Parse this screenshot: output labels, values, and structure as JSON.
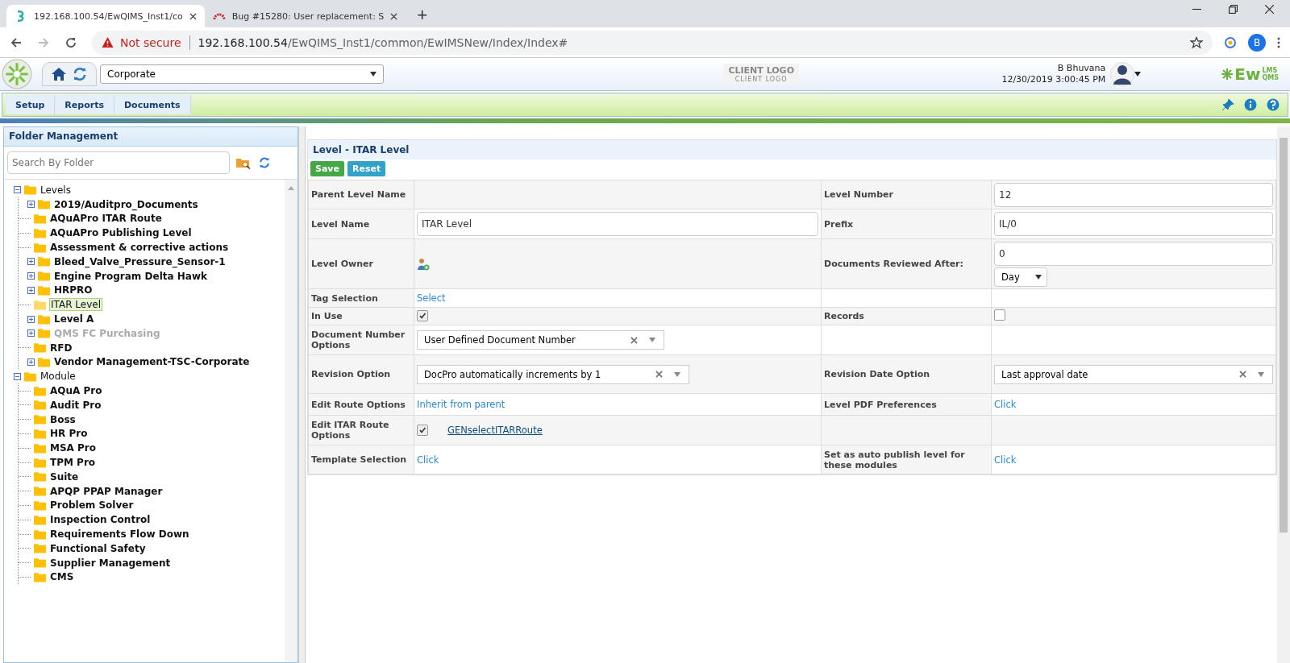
{
  "browser": {
    "tabs": [
      {
        "title": "192.168.100.54/EwQIMS_Inst1/co",
        "selected": true
      },
      {
        "title": "Bug #15280: User replacement: S",
        "selected": false
      }
    ],
    "new_tab": "+",
    "security": "Not secure",
    "url_host": "192.168.100.54",
    "url_path": "/EwQIMS_Inst1/common/EwIMSNew/Index/Index#",
    "profile": "B"
  },
  "header": {
    "site": "Corporate",
    "client_logo": "CLIENT LOGO",
    "client_logo_sub": "CLIENT LOGO",
    "user": "B Bhuvana",
    "datetime": "12/30/2019 3:00:45 PM",
    "brand": "Ew",
    "brand_sup": "LMS",
    "brand_sub": "QMS"
  },
  "menu": [
    "Setup",
    "Reports",
    "Documents"
  ],
  "folder_panel": {
    "title": "Folder Management",
    "search": {
      "placeholder": "Search By Folder"
    },
    "tree": [
      {
        "label": "Levels",
        "kind": "branch",
        "expanded": true,
        "selected": false,
        "disabled": false,
        "children": [
          {
            "label": "2019/Auditpro_Documents",
            "kind": "branch",
            "expanded": false,
            "selected": false,
            "disabled": false
          },
          {
            "label": "AQuAPro ITAR Route",
            "kind": "leaf",
            "selected": false,
            "disabled": false
          },
          {
            "label": "AQuAPro Publishing Level",
            "kind": "leaf",
            "selected": false,
            "disabled": false
          },
          {
            "label": "Assessment & corrective actions",
            "kind": "leaf",
            "selected": false,
            "disabled": false
          },
          {
            "label": "Bleed_Valve_Pressure_Sensor-1",
            "kind": "branch",
            "expanded": false,
            "selected": false,
            "disabled": false
          },
          {
            "label": "Engine Program Delta Hawk",
            "kind": "branch",
            "expanded": false,
            "selected": false,
            "disabled": false
          },
          {
            "label": "HRPRO",
            "kind": "branch",
            "expanded": false,
            "selected": false,
            "disabled": false
          },
          {
            "label": "ITAR Level",
            "kind": "leaf",
            "selected": true,
            "disabled": false
          },
          {
            "label": "Level A",
            "kind": "branch",
            "expanded": false,
            "selected": false,
            "disabled": false
          },
          {
            "label": "QMS FC Purchasing",
            "kind": "branch",
            "expanded": false,
            "selected": false,
            "disabled": true
          },
          {
            "label": "RFD",
            "kind": "leaf",
            "selected": false,
            "disabled": false
          },
          {
            "label": "Vendor Management-TSC-Corporate",
            "kind": "branch",
            "expanded": false,
            "selected": false,
            "disabled": false
          }
        ]
      },
      {
        "label": "Module",
        "kind": "branch",
        "expanded": true,
        "selected": false,
        "disabled": false,
        "children": [
          {
            "label": "AQuA Pro",
            "kind": "leaf",
            "selected": false,
            "disabled": false
          },
          {
            "label": "Audit Pro",
            "kind": "leaf",
            "selected": false,
            "disabled": false
          },
          {
            "label": "Boss",
            "kind": "leaf",
            "selected": false,
            "disabled": false
          },
          {
            "label": "HR Pro",
            "kind": "leaf",
            "selected": false,
            "disabled": false
          },
          {
            "label": "MSA Pro",
            "kind": "leaf",
            "selected": false,
            "disabled": false
          },
          {
            "label": "TPM Pro",
            "kind": "leaf",
            "selected": false,
            "disabled": false
          },
          {
            "label": "Suite",
            "kind": "leaf",
            "selected": false,
            "disabled": false
          },
          {
            "label": "APQP PPAP Manager",
            "kind": "leaf",
            "selected": false,
            "disabled": false
          },
          {
            "label": "Problem Solver",
            "kind": "leaf",
            "selected": false,
            "disabled": false
          },
          {
            "label": "Inspection Control",
            "kind": "leaf",
            "selected": false,
            "disabled": false
          },
          {
            "label": "Requirements Flow Down",
            "kind": "leaf",
            "selected": false,
            "disabled": false
          },
          {
            "label": "Functional Safety",
            "kind": "leaf",
            "selected": false,
            "disabled": false
          },
          {
            "label": "Supplier Management",
            "kind": "leaf",
            "selected": false,
            "disabled": false
          },
          {
            "label": "CMS",
            "kind": "leaf",
            "selected": false,
            "disabled": false
          }
        ]
      }
    ]
  },
  "form": {
    "title": "Level - ITAR Level",
    "buttons": [
      {
        "label": "Save",
        "kind": "save"
      },
      {
        "label": "Reset",
        "kind": "reset"
      }
    ],
    "rows": [
      [
        {
          "kind": "label",
          "text": "Parent Level Name"
        },
        {
          "kind": "empty"
        },
        {
          "kind": "label",
          "text": "Level Number"
        },
        {
          "kind": "input",
          "value": "12"
        }
      ],
      [
        {
          "kind": "label",
          "text": "Level Name"
        },
        {
          "kind": "input",
          "value": "ITAR Level"
        },
        {
          "kind": "label",
          "text": "Prefix"
        },
        {
          "kind": "input",
          "value": "IL/0"
        }
      ],
      [
        {
          "kind": "label",
          "text": "Level Owner"
        },
        {
          "kind": "owner"
        },
        {
          "kind": "label",
          "text": "Documents Reviewed After:"
        },
        {
          "kind": "review",
          "value": "0",
          "unit": "Day"
        }
      ],
      [
        {
          "kind": "label",
          "text": "Tag Selection"
        },
        {
          "kind": "link",
          "text": "Select"
        },
        {
          "kind": "empty"
        },
        {
          "kind": "empty"
        }
      ],
      [
        {
          "kind": "label",
          "text": "In Use"
        },
        {
          "kind": "checkbox",
          "checked": true
        },
        {
          "kind": "label",
          "text": "Records"
        },
        {
          "kind": "checkbox",
          "checked": false
        }
      ],
      [
        {
          "kind": "label",
          "text": "Document Number Options"
        },
        {
          "kind": "combo",
          "value": "User Defined Document Number"
        },
        {
          "kind": "empty"
        },
        {
          "kind": "empty"
        }
      ],
      [
        {
          "kind": "label",
          "text": "Revision Option"
        },
        {
          "kind": "combo",
          "value": "DocPro automatically increments by 1"
        },
        {
          "kind": "label",
          "text": "Revision Date Option"
        },
        {
          "kind": "combo",
          "value": "Last approval date"
        }
      ],
      [
        {
          "kind": "label",
          "text": "Edit Route Options"
        },
        {
          "kind": "link",
          "text": "Inherit from parent"
        },
        {
          "kind": "label",
          "text": "Level PDF Preferences"
        },
        {
          "kind": "link",
          "text": "Click"
        }
      ],
      [
        {
          "kind": "label",
          "text": "Edit ITAR Route Options"
        },
        {
          "kind": "check_link",
          "checked": true,
          "link": "GENselectITARRoute"
        },
        {
          "kind": "empty"
        },
        {
          "kind": "empty"
        }
      ],
      [
        {
          "kind": "label",
          "text": "Template Selection"
        },
        {
          "kind": "link",
          "text": "Click"
        },
        {
          "kind": "label",
          "text": "Set as auto publish level for these modules"
        },
        {
          "kind": "link",
          "text": "Click"
        }
      ]
    ]
  }
}
